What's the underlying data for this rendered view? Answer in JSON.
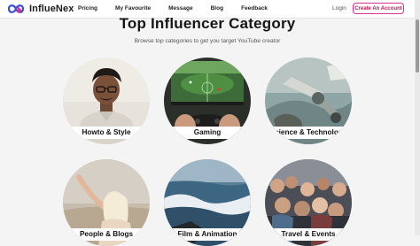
{
  "brand": {
    "name": "InflueNex",
    "logo_icon": "infinity-heart-logo-icon"
  },
  "nav": {
    "items": [
      {
        "label": "Pricing"
      },
      {
        "label": "My Favourite"
      },
      {
        "label": "Message"
      },
      {
        "label": "Blog"
      },
      {
        "label": "Feedback"
      }
    ],
    "login": "Login",
    "cta": "Create An Account"
  },
  "header": {
    "title": "Top Influencer Category",
    "subtitle": "Browse top categories to get you target YouTube creator"
  },
  "categories": [
    {
      "label": "Howto & Style"
    },
    {
      "label": "Gaming"
    },
    {
      "label": "Science & Technology"
    },
    {
      "label": "People & Blogs"
    },
    {
      "label": "Film & Animation"
    },
    {
      "label": "Travel & Events"
    }
  ],
  "colors": {
    "accent": "#d6338b",
    "background": "#f4f4f4"
  }
}
